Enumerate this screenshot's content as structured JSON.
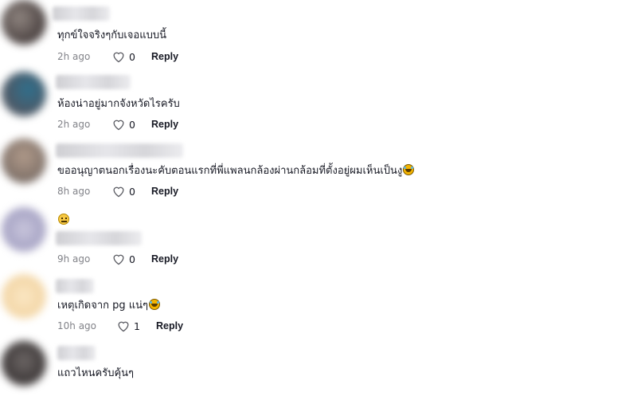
{
  "comments": [
    {
      "text": "ทุกข์ใจจริงๆกับเจอแบบนี้",
      "time": "2h ago",
      "likes": "0",
      "reply": "Reply",
      "emoji": ""
    },
    {
      "text": "ห้องน่าอยู่มากจังหวัดไรครับ",
      "time": "2h ago",
      "likes": "0",
      "reply": "Reply",
      "emoji": ""
    },
    {
      "text": "ขออนุญาตนอกเรื่องนะคับตอนแรกที่พี่แพลนกล้องผ่านกล้อมที่ตั้งอยู่ผมเห็นเป็นงู",
      "time": "8h ago",
      "likes": "0",
      "reply": "Reply",
      "emoji": "laughing-tears-emoji"
    },
    {
      "text": "",
      "time": "9h ago",
      "likes": "0",
      "reply": "Reply",
      "emoji": "neutral-face-emoji"
    },
    {
      "text": "เหตุเกิดจาก pg แน่ๆ",
      "time": "10h ago",
      "likes": "1",
      "reply": "Reply",
      "emoji": "laughing-tears-emoji"
    },
    {
      "text": "แถวไหนครับคุ้นๆ",
      "time": "",
      "likes": "",
      "reply": "",
      "emoji": ""
    }
  ],
  "icons": {
    "like": "heart-outline-icon"
  },
  "colors": {
    "text": "#161823",
    "muted": "#8a8b91",
    "background": "#ffffff"
  }
}
